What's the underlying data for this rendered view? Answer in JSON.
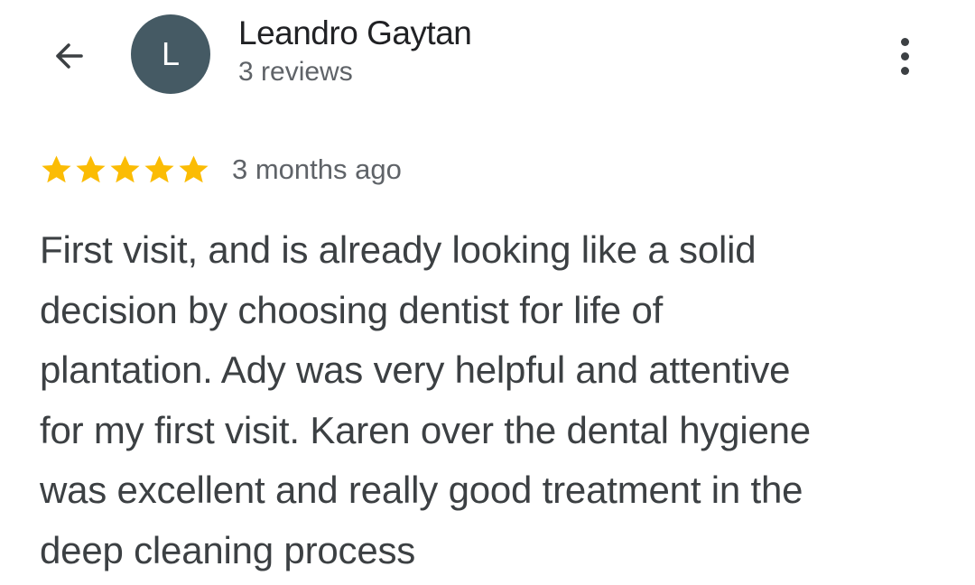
{
  "header": {
    "avatar_letter": "L",
    "avatar_color": "#455a64",
    "name": "Leandro Gaytan",
    "reviews_count": "3 reviews",
    "back_icon": "arrow-back-icon",
    "more_icon": "more-vert-icon"
  },
  "review": {
    "rating": 5,
    "max_rating": 5,
    "star_color": "#fbbc04",
    "time_ago": "3 months ago",
    "text_lines": [
      "First visit, and is already looking like a solid",
      "decision by choosing dentist for life of",
      "plantation. Ady was very helpful and attentive",
      "for my first visit. Karen over the dental hygiene",
      "was excellent and really good treatment in the",
      "deep cleaning process"
    ]
  }
}
